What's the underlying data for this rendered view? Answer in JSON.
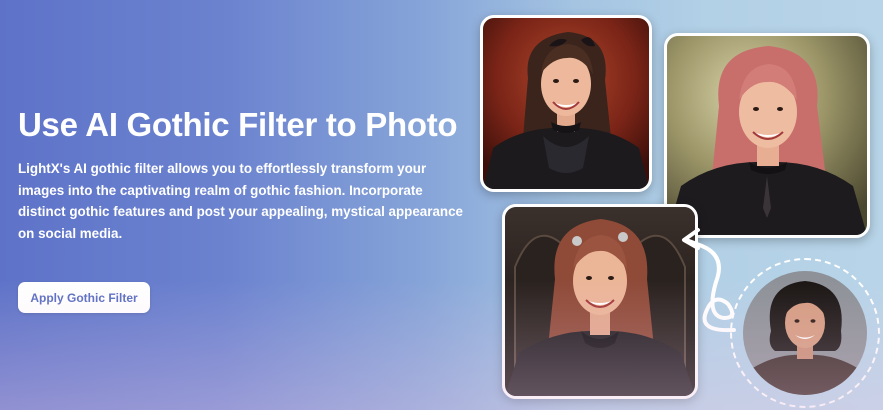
{
  "hero": {
    "title": "Use AI Gothic Filter to Photo",
    "description": "LightX's AI gothic filter allows you to effortlessly transform your images into the captivating realm of gothic fashion. Incorporate distinct gothic features and post your appealing, mystical appearance on social media.",
    "cta_label": "Apply Gothic Filter"
  },
  "colors": {
    "gradient_start": "#5e73c8",
    "gradient_end": "#b8d4e8",
    "cta_text": "#5b6fc2",
    "title_text": "#ffffff"
  },
  "images": [
    {
      "icon": "gothic-portrait-red-background"
    },
    {
      "icon": "gothic-portrait-olive-background"
    },
    {
      "icon": "gothic-portrait-arched-background"
    },
    {
      "icon": "original-portrait-grey-background"
    }
  ],
  "decorations": {
    "arrow_icon": "curved-arrow-icon",
    "frame_icon": "dashed-circle-frame"
  }
}
